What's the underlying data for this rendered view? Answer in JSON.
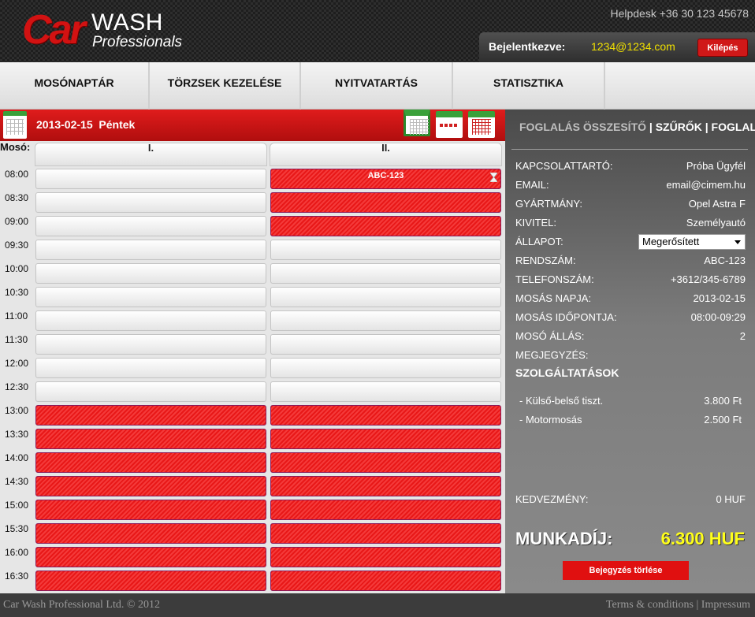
{
  "header": {
    "logo": {
      "car": "Car",
      "wash": "WASH",
      "professionals": "Professionals"
    },
    "helpdesk": "Helpdesk +36 30 123 45678",
    "login_label": "Bejelentkezve:",
    "login_email": "1234@1234.com",
    "logout_label": "Kilépés"
  },
  "nav": [
    {
      "label": "MOSÓNAPTÁR"
    },
    {
      "label": "TÖRZSEK KEZELÉSE"
    },
    {
      "label": "NYITVATARTÁS"
    },
    {
      "label": "STATISZTIKA"
    }
  ],
  "calendar": {
    "date": "2013-02-15",
    "day": "Péntek",
    "washer_label": "Mosó:",
    "columns": [
      "I.",
      "II."
    ],
    "times": [
      "08:00",
      "08:30",
      "09:00",
      "09:30",
      "10:00",
      "10:30",
      "11:00",
      "11:30",
      "12:00",
      "12:30",
      "13:00",
      "13:30",
      "14:00",
      "14:30",
      "15:00",
      "15:30",
      "16:00",
      "16:30"
    ],
    "booking_label": "ABC-123",
    "slots": [
      [
        "free",
        "booked"
      ],
      [
        "free",
        "booked"
      ],
      [
        "free",
        "booked"
      ],
      [
        "free",
        "free"
      ],
      [
        "free",
        "free"
      ],
      [
        "free",
        "free"
      ],
      [
        "free",
        "free"
      ],
      [
        "free",
        "free"
      ],
      [
        "free",
        "free"
      ],
      [
        "free",
        "free"
      ],
      [
        "booked",
        "booked"
      ],
      [
        "booked",
        "booked"
      ],
      [
        "booked",
        "booked"
      ],
      [
        "booked",
        "booked"
      ],
      [
        "booked",
        "booked"
      ],
      [
        "booked",
        "booked"
      ],
      [
        "booked",
        "booked"
      ],
      [
        "booked",
        "booked"
      ]
    ],
    "colors": {
      "booked": "#e81818",
      "accent": "#d01818",
      "green": "#3aa03a"
    }
  },
  "panel": {
    "tabs": {
      "summary": "FOGLALÁS ÖSSZESÍTŐ",
      "sep1": " | ",
      "filters": "SZŰRŐK",
      "sep2": " | ",
      "booking": "FOGLALÁS"
    },
    "fields": [
      {
        "key": "KAPCSOLATTARTÓ:",
        "value": "Próba Ügyfél"
      },
      {
        "key": "EMAIL:",
        "value": "email@cimem.hu"
      },
      {
        "key": "GYÁRTMÁNY:",
        "value": "Opel Astra F"
      },
      {
        "key": "KIVITEL:",
        "value": "Személyautó"
      },
      {
        "key": "ÁLLAPOT:",
        "value": "Megerősített"
      },
      {
        "key": "RENDSZÁM:",
        "value": "ABC-123"
      },
      {
        "key": "TELEFONSZÁM:",
        "value": "+3612/345-6789"
      },
      {
        "key": "MOSÁS NAPJA:",
        "value": "2013-02-15"
      },
      {
        "key": "MOSÁS IDŐPONTJA:",
        "value": "08:00-09:29"
      },
      {
        "key": "MOSÓ ÁLLÁS:",
        "value": "2"
      },
      {
        "key": "MEGJEGYZÉS:",
        "value": ""
      }
    ],
    "services_title": "SZOLGÁLTATÁSOK",
    "services": [
      {
        "name": "- Külső-belső tiszt.",
        "price": "3.800 Ft"
      },
      {
        "name": "- Motormosás",
        "price": "2.500 Ft"
      }
    ],
    "discount_label": "KEDVEZMÉNY:",
    "discount_value": "0 HUF",
    "total_label": "MUNKADÍJ:",
    "total_value": "6.300 HUF",
    "delete_label": "Bejegyzés törlése"
  },
  "footer": {
    "copyright": "Car Wash Professional Ltd. © 2012",
    "terms": "Terms & conditions",
    "sep": " | ",
    "impressum": "Impressum"
  }
}
